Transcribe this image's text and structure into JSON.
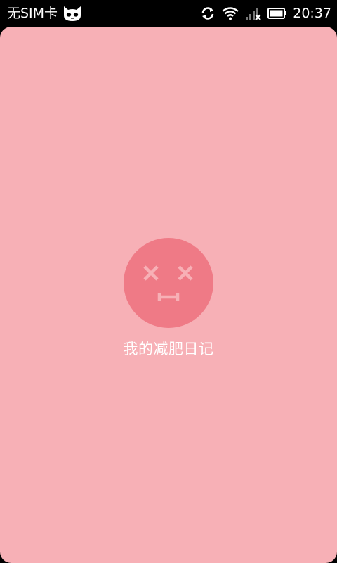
{
  "status_bar": {
    "carrier": "无SIM卡",
    "time": "20:37",
    "icons": [
      "cat-face-icon",
      "sync-icon",
      "wifi-icon",
      "no-signal-icon",
      "battery-icon"
    ]
  },
  "main": {
    "title": "我的减肥日记",
    "face_icon": "dizzy-face-icon"
  },
  "colors": {
    "background": "#f7b0b6",
    "face": "#ef7a86",
    "face_marks": "#f7b0b6",
    "text": "#ffffff",
    "status_bar": "#000000"
  }
}
